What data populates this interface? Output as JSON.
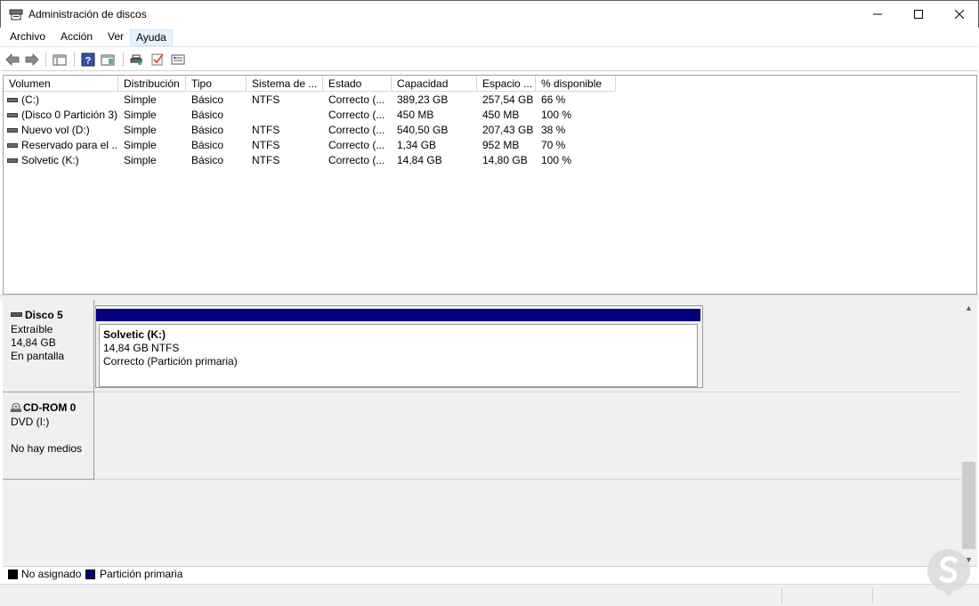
{
  "window": {
    "title": "Administración de discos",
    "icon": "disk-management-icon",
    "controls": [
      "minimize-icon",
      "maximize-icon",
      "close-icon"
    ]
  },
  "menu": [
    {
      "label": "Archivo"
    },
    {
      "label": "Acción"
    },
    {
      "label": "Ver"
    },
    {
      "label": "Ayuda",
      "active": true
    }
  ],
  "toolbar": [
    "back-icon",
    "forward-icon",
    "console-tree-icon",
    "help-icon",
    "properties-icon",
    "rescan-disks-icon",
    "checkmark-icon",
    "view-icon"
  ],
  "volume_table": {
    "columns": [
      "Volumen",
      "Distribución",
      "Tipo",
      "Sistema de ...",
      "Estado",
      "Capacidad",
      "Espacio ...",
      "% disponible"
    ],
    "rows": [
      [
        "(C:)",
        "Simple",
        "Básico",
        "NTFS",
        "Correcto (...",
        "389,23 GB",
        "257,54 GB",
        "66 %"
      ],
      [
        "(Disco 0 Partición 3)",
        "Simple",
        "Básico",
        "",
        "Correcto (...",
        "450 MB",
        "450 MB",
        "100 %"
      ],
      [
        "Nuevo vol (D:)",
        "Simple",
        "Básico",
        "NTFS",
        "Correcto (...",
        "540,50 GB",
        "207,43 GB",
        "38 %"
      ],
      [
        "Reservado para el ...",
        "Simple",
        "Básico",
        "NTFS",
        "Correcto (...",
        "1,34 GB",
        "952 MB",
        "70 %"
      ],
      [
        "Solvetic (K:)",
        "Simple",
        "Básico",
        "NTFS",
        "Correcto (...",
        "14,84 GB",
        "14,80 GB",
        "100 %"
      ]
    ]
  },
  "disks": [
    {
      "name": "Disco 5",
      "type": "Extraíble",
      "size": "14,84 GB",
      "status": "En pantalla",
      "partition": {
        "name": "Solvetic  (K:)",
        "size_fs": "14,84 GB NTFS",
        "status": "Correcto (Partición primaria)",
        "color": "#00007f"
      }
    },
    {
      "name": "CD-ROM 0",
      "type": "DVD (I:)",
      "status": "No hay medios"
    }
  ],
  "legend": [
    {
      "label": "No asignado",
      "color": "#000000"
    },
    {
      "label": "Partición primaria",
      "color": "#00007f"
    }
  ]
}
